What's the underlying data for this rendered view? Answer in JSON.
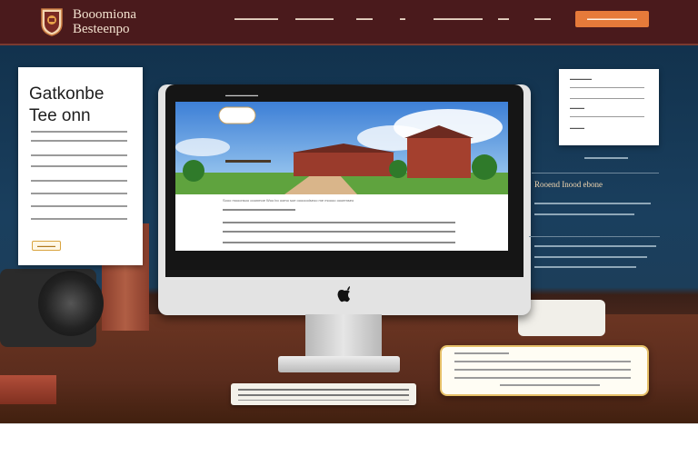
{
  "header": {
    "logo_line1": "Booomiona",
    "logo_line2": "Besteenpo",
    "nav_items": [
      "▬▬▬▬▬▬▬▬",
      "▬▬▬▬▬▬▬",
      "▬▬▬",
      "▬",
      "▬▬▬▬▬▬▬▬▬",
      "▬▬",
      "▬▬▬"
    ],
    "cta_label": "▬▬▬▬▬▬▬▬▬▬▬"
  },
  "hero": {
    "card_title_line1": "Gatkonbe",
    "card_title_line2": "Tee onn",
    "card_button": "▬▬▬▬▬",
    "right_card_labels": [
      "▬▬▬▬▬▬",
      "▬▬▬▬",
      "▬▬▬▬"
    ],
    "side_heading": "Rooend Inood ebone",
    "screen_label": "▬▬▬▬▬▬▬▬▬",
    "screen_caption": "Sooo mooonsoo ooonmoe Woo bo oomo soe oooooolseoo me moooo oooemseo"
  },
  "colors": {
    "header_bg": "#4a1a1c",
    "accent": "#e67a3a",
    "hero_bg": "#12324d",
    "desk": "#5a2c1d"
  }
}
